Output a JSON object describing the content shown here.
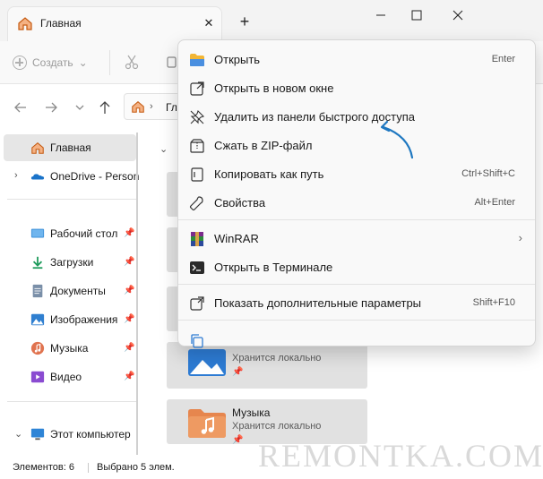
{
  "window": {
    "tab_title": "Главная",
    "tab_close": "✕",
    "new_tab": "+",
    "icons": [
      "home-icon",
      "minimize-icon",
      "maximize-icon",
      "close-icon"
    ]
  },
  "toolbar": {
    "create_label": "Создать",
    "create_chevron": "⌄"
  },
  "address": {
    "path_text": "Гла"
  },
  "sidebar": {
    "items": [
      {
        "label": "Главная",
        "icon": "home-icon",
        "active": true
      },
      {
        "label": "OneDrive - Person",
        "icon": "onedrive-icon",
        "expandable": true
      },
      {
        "label": "Рабочий стол",
        "icon": "desktop-icon",
        "pinned": true
      },
      {
        "label": "Загрузки",
        "icon": "downloads-icon",
        "pinned": true
      },
      {
        "label": "Документы",
        "icon": "documents-icon",
        "pinned": true
      },
      {
        "label": "Изображения",
        "icon": "pictures-icon",
        "pinned": true
      },
      {
        "label": "Музыка",
        "icon": "music-icon",
        "pinned": true
      },
      {
        "label": "Видео",
        "icon": "videos-icon",
        "pinned": true
      },
      {
        "label": "Этот компьютер",
        "icon": "this-pc-icon",
        "expandable": true
      }
    ]
  },
  "content": {
    "tiles": [
      {
        "name": "",
        "sub": ""
      },
      {
        "name": "",
        "sub": ""
      },
      {
        "name": "",
        "sub": ""
      },
      {
        "name": "",
        "sub": ""
      },
      {
        "name": "",
        "sub": "Хранится локально"
      },
      {
        "name": "Музыка",
        "sub": "Хранится локально"
      }
    ]
  },
  "status": {
    "items_count": "Элементов: 6",
    "selected": "Выбрано 5 элем."
  },
  "context_menu": {
    "items": [
      {
        "label": "Открыть",
        "shortcut": "Enter",
        "icon": "folder-open-icon"
      },
      {
        "label": "Открыть в новом окне",
        "shortcut": "",
        "icon": "new-window-icon"
      },
      {
        "label": "Удалить из панели быстрого доступа",
        "shortcut": "",
        "icon": "unpin-icon"
      },
      {
        "label": "Сжать в ZIP-файл",
        "shortcut": "",
        "icon": "zip-icon"
      },
      {
        "label": "Копировать как путь",
        "shortcut": "Ctrl+Shift+C",
        "icon": "copy-path-icon"
      },
      {
        "label": "Свойства",
        "shortcut": "Alt+Enter",
        "icon": "properties-icon"
      },
      {
        "label": "WinRAR",
        "shortcut": "",
        "icon": "winrar-icon",
        "submenu": true
      },
      {
        "label": "Открыть в Терминале",
        "shortcut": "",
        "icon": "terminal-icon"
      },
      {
        "label": "Показать дополнительные параметры",
        "shortcut": "Shift+F10",
        "icon": "more-options-icon"
      }
    ],
    "submenu_arrow": "›",
    "bottom_icon": "copy-icon"
  },
  "annotation": {
    "color": "#1f78c1"
  },
  "watermark": "REMONTKA.COM"
}
